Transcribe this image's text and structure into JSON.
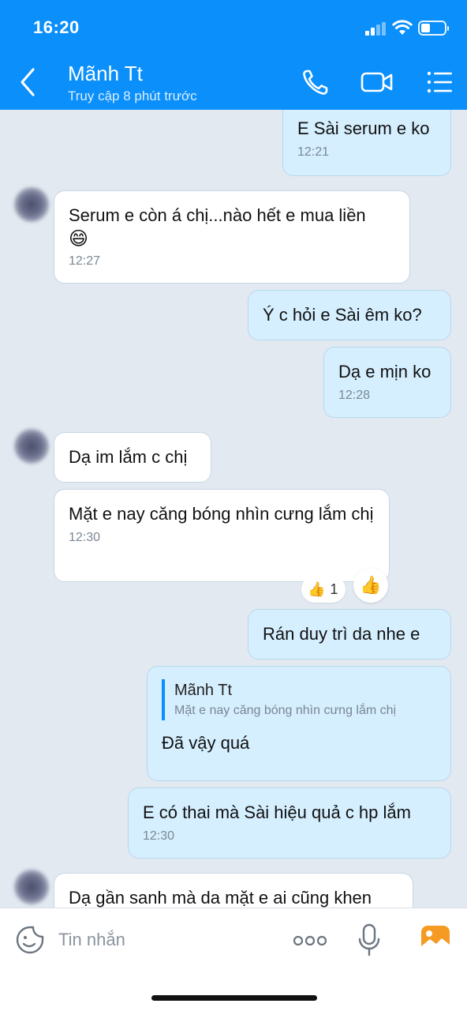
{
  "status_bar": {
    "time": "16:20"
  },
  "header": {
    "contact_name": "Mãnh Tt",
    "contact_status": "Truy cập 8 phút trước",
    "accent_color": "#0a8ffb"
  },
  "messages": [
    {
      "side": "out",
      "text": "E Sài serum e ko",
      "time": "12:21"
    },
    {
      "side": "in",
      "text": "Serum e còn á chị...nào hết e mua liền",
      "emoji": "😄",
      "time": "12:27"
    },
    {
      "side": "out",
      "text": "Ý c hỏi e Sài êm ko?"
    },
    {
      "side": "out",
      "text": "Dạ e mịn ko",
      "time": "12:28"
    },
    {
      "side": "in",
      "text": "Dạ im lắm c chị"
    },
    {
      "side": "in",
      "text": "Mặt e nay căng bóng nhìn cưng lắm chị",
      "time": "12:30",
      "reaction": {
        "emoji": "👍",
        "count": "1"
      }
    },
    {
      "side": "out",
      "text": "Rán duy trì da nhe e"
    },
    {
      "side": "out",
      "quote": {
        "name": "Mãnh Tt",
        "text": "Mặt e nay căng bóng nhìn cưng lắm chị"
      },
      "text": "Đã vậy quá"
    },
    {
      "side": "out",
      "text": "E có thai mà Sài hiệu quả c hp lắm",
      "time": "12:30"
    },
    {
      "side": "in",
      "text": "Dạ gần sanh mà da mặt e ai cũng khen"
    }
  ],
  "reaction_button": {
    "emoji": "👍"
  },
  "input_bar": {
    "placeholder": "Tin nhắn"
  },
  "icons": [
    "back-arrow-icon",
    "phone-icon",
    "video-call-icon",
    "menu-list-icon",
    "sticker-icon",
    "more-options-icon",
    "microphone-icon",
    "image-icon"
  ]
}
